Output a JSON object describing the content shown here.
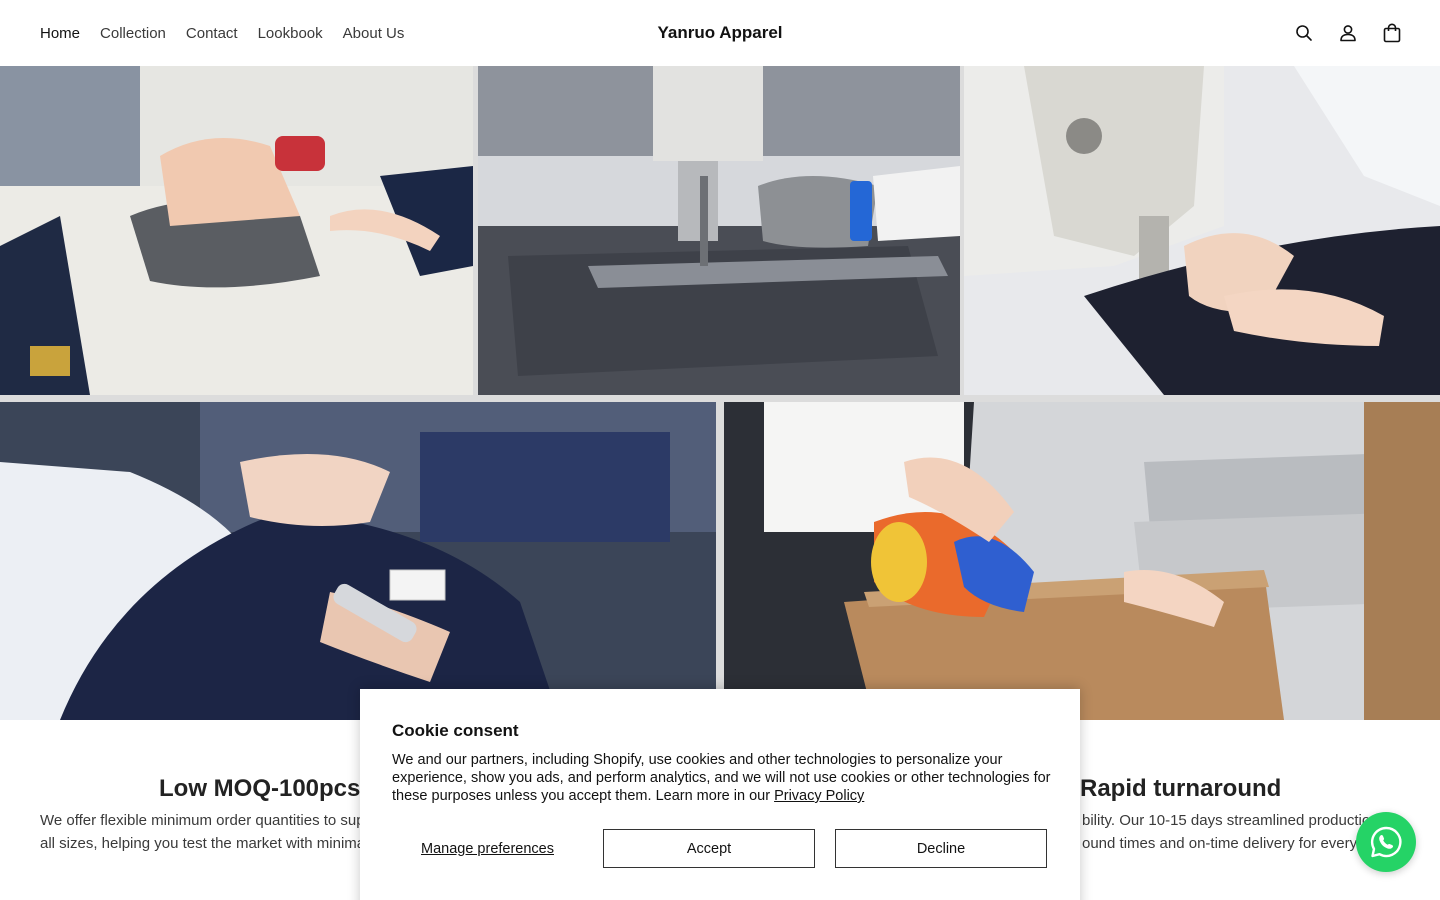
{
  "header": {
    "nav": [
      "Home",
      "Collection",
      "Contact",
      "Lookbook",
      "About Us"
    ],
    "logo": "Yanruo Apparel",
    "icons": [
      "search-icon",
      "account-icon",
      "cart-icon"
    ]
  },
  "gallery": {
    "photos": [
      "ironing-photo",
      "fabric-cutting-photo",
      "sewing-machine-photo",
      "label-inspection-photo",
      "box-taping-photo"
    ]
  },
  "features": [
    {
      "title": "Low MOQ-100pcs",
      "text_line1": "We offer flexible minimum order quantities to sup",
      "text_line2": "all sizes, helping you test the market with minima"
    },
    {
      "title": "Rapid turnaround",
      "text_line1": "bility. Our 10-15 days streamlined production",
      "text_line2": "ound times and on-time delivery for every"
    }
  ],
  "cookie": {
    "title": "Cookie consent",
    "body": "We and our partners, including Shopify, use cookies and other technologies to personalize your experience, show you ads, and perform analytics, and we will not use cookies or other technologies for these purposes unless you accept them. Learn more in our ",
    "policy_link": "Privacy Policy",
    "manage_label": "Manage preferences",
    "accept_label": "Accept",
    "decline_label": "Decline"
  },
  "colors": {
    "whatsapp": "#25d366",
    "text": "#121212"
  }
}
